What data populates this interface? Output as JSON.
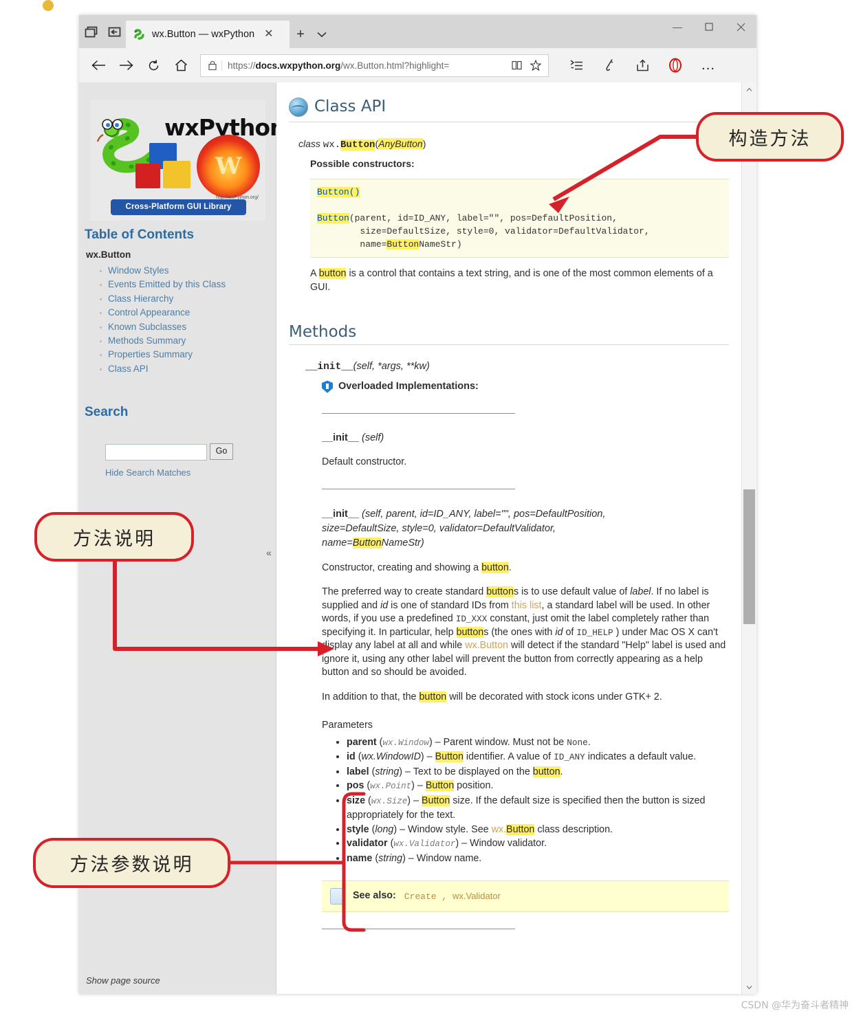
{
  "browser": {
    "tab": {
      "title": "wx.Button — wxPython",
      "close_label": "✕",
      "favicon": "python-snake-icon"
    },
    "tabstrip_buttons": [
      "tab-preview-icon",
      "set-aside-tabs-icon"
    ],
    "new_tab_label": "+",
    "tab_menu_label": "⌄",
    "window_controls": {
      "minimize": "—",
      "maximize": "❐",
      "close": "✕"
    },
    "nav": {
      "back": "←",
      "forward": "→",
      "refresh": "↻",
      "home": "⌂",
      "lock": "🔒",
      "url_prefix": "https://",
      "url_domain": "docs.wxpython.org",
      "url_path": "/wx.Button.html?highlight=",
      "reading_view": "book-icon",
      "favorite": "★",
      "reading_list": "reading-list-icon",
      "notes": "notes-pen-icon",
      "share": "share-icon",
      "opera_badge": "O",
      "more": "…"
    }
  },
  "sidebar": {
    "logo": {
      "wordmark": "wxPython",
      "ribbon": "Cross-Platform GUI Library",
      "url": "http://wxPython.org/",
      "phoenix_letter": "W"
    },
    "toc_heading": "Table of Contents",
    "toc_root": "wx.Button",
    "toc_items": [
      "Window Styles",
      "Events Emitted by this Class",
      "Class Hierarchy",
      "Control Appearance",
      "Known Subclasses",
      "Methods Summary",
      "Properties Summary",
      "Class API"
    ],
    "search_heading": "Search",
    "search_value": "",
    "search_placeholder": "",
    "go_label": "Go",
    "hide_matches": "Hide Search Matches",
    "show_page_source": "Show page source",
    "collapse_label": "«"
  },
  "content": {
    "class_api_heading": "Class API",
    "class_line": {
      "kw": "class",
      "module": "wx.",
      "name": "Button",
      "open": "(",
      "base": "AnyButton",
      "close": ")"
    },
    "possible_constructors": "Possible constructors:",
    "constructor_code_1": "Button()",
    "constructor_code_2_name": "Button",
    "constructor_code_2_args_line1": "(parent, id=ID_ANY, label=\"\", pos=DefaultPosition,",
    "constructor_code_2_args_line2": "        size=DefaultSize, style=0, validator=DefaultValidator,",
    "constructor_code_2_args_line3_pre": "        name=",
    "constructor_code_2_args_line3_hl": "Button",
    "constructor_code_2_args_line3_post": "NameStr)",
    "intro_pre": "A ",
    "intro_hl": "button",
    "intro_post": " is a control that contains a text string, and is one of the most common elements of a GUI.",
    "methods_heading": "Methods",
    "init_signature_name": "__init__",
    "init_signature_args": "(self, *args, **kw)",
    "overloaded_label": "Overloaded Implementations:",
    "init_self_name": "__init__",
    "init_self_args": "(self)",
    "default_constructor": "Default constructor.",
    "init_full_name": "__init__",
    "init_full_line1": " (self, parent, id=ID_ANY, label=\"\", pos=DefaultPosition,",
    "init_full_line2": "size=DefaultSize, style=0, validator=DefaultValidator,",
    "init_full_line3_pre": "name=",
    "init_full_line3_hl": "Button",
    "init_full_line3_post": "NameStr)",
    "ctor_desc_pre": "Constructor, creating and showing a ",
    "ctor_desc_hl": "button",
    "ctor_desc_post": ".",
    "preferred_p1": "The preferred way to create standard ",
    "preferred_hl1": "button",
    "preferred_p2": "s is to use default value of ",
    "preferred_ital_label": "label",
    "preferred_p3": ". If no label is supplied and ",
    "preferred_ital_id": "id",
    "preferred_p4": " is one of standard IDs from ",
    "preferred_link": "this list",
    "preferred_p5": ", a standard label will be used. In other words, if you use a predefined ",
    "preferred_mono1": "ID_XXX",
    "preferred_p6": " constant, just omit the label completely rather than specifying it. In particular, help ",
    "preferred_hl2": "button",
    "preferred_p7": "s (the ones with ",
    "preferred_ital_id2": "id",
    "preferred_p8": " of ",
    "preferred_mono2": "ID_HELP",
    "preferred_p9": " ) under Mac OS X can't display any label at all and while ",
    "preferred_link2": "wx.Button",
    "preferred_p10": " will detect if the standard \"Help\" label is used and ignore it, using any other label will prevent the button from correctly appearing as a help button and so should be avoided.",
    "addition_pre": "In addition to that, the ",
    "addition_hl": "button",
    "addition_post": " will be decorated with stock icons under GTK+ 2.",
    "parameters_label": "Parameters",
    "parameters": [
      {
        "name": "parent",
        "type": "wx.Window",
        "type_style": "mono",
        "desc_pre": " – Parent window. Must not be ",
        "desc_mono": "None",
        "desc_post": "."
      },
      {
        "name": "id",
        "type": "wx.WindowID",
        "type_style": "italic",
        "desc_pre": " – ",
        "desc_hl": "Button",
        "desc_mid": " identifier. A value of ",
        "desc_mono": "ID_ANY",
        "desc_post": " indicates a default value."
      },
      {
        "name": "label",
        "type": "string",
        "type_style": "italic",
        "desc_pre": " – Text to be displayed on the ",
        "desc_hl": "button",
        "desc_post": "."
      },
      {
        "name": "pos",
        "type": "wx.Point",
        "type_style": "mono",
        "desc_pre": " – ",
        "desc_hl": "Button",
        "desc_post": " position."
      },
      {
        "name": "size",
        "type": "wx.Size",
        "type_style": "mono",
        "desc_pre": " – ",
        "desc_hl": "Button",
        "desc_post": " size. If the default size is specified then the button is sized appropriately for the text."
      },
      {
        "name": "style",
        "type": "long",
        "type_style": "italic",
        "desc_pre": " – Window style. See ",
        "desc_link": "wx.",
        "desc_hl": "Button",
        "desc_post": " class description."
      },
      {
        "name": "validator",
        "type": "wx.Validator",
        "type_style": "mono",
        "desc_pre": " – Window validator.",
        "desc_post": ""
      },
      {
        "name": "name",
        "type": "string",
        "type_style": "italic",
        "desc_pre": " – Window name.",
        "desc_post": ""
      }
    ],
    "see_also_label": "See also:",
    "see_also_link1": "Create",
    "see_also_sep": " , ",
    "see_also_link2": "wx.Validator"
  },
  "annotations": {
    "callout_constructor": "构造方法",
    "callout_method_desc": "方法说明",
    "callout_param_desc": "方法参数说明",
    "accent_color": "#d6212a",
    "callout_bg": "#f5efd8"
  },
  "watermark": "CSDN @华为奋斗者精神"
}
